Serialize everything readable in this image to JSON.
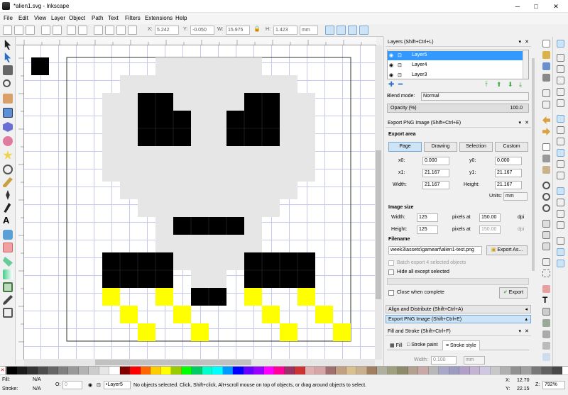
{
  "window": {
    "title": "*alien1.svg - Inkscape",
    "minimize": "─",
    "maximize": "□",
    "close": "✕"
  },
  "menu": [
    "File",
    "Edit",
    "View",
    "Layer",
    "Object",
    "Path",
    "Text",
    "Filters",
    "Extensions",
    "Help"
  ],
  "toolbar": {
    "x_label": "X:",
    "x_value": "5.242",
    "y_label": "Y:",
    "y_value": "-0.050",
    "w_label": "W:",
    "w_value": "15.975",
    "h_label": "H:",
    "h_value": "1.423",
    "units": "mm"
  },
  "layers": {
    "title": "Layers (Shift+Ctrl+L)",
    "items": [
      "Layer5",
      "Layer4",
      "Layer3"
    ],
    "blend_label": "Blend mode:",
    "blend_value": "Normal",
    "opacity_label": "Opacity (%)",
    "opacity_value": "100.0",
    "opacity": 1.0
  },
  "export": {
    "title": "Export PNG Image (Shift+Ctrl+E)",
    "area_heading": "Export area",
    "area_tabs": [
      "Page",
      "Drawing",
      "Selection",
      "Custom"
    ],
    "x0_label": "x0:",
    "x0": "0.000",
    "y0_label": "y0:",
    "y0": "0.000",
    "x1_label": "x1:",
    "x1": "21.167",
    "y1_label": "y1:",
    "y1": "21.167",
    "width_label": "Width:",
    "width": "21.167",
    "height_label": "Height:",
    "height": "21.167",
    "units_label": "Units:",
    "units": "mm",
    "size_heading": "Image size",
    "px_width_label": "Width:",
    "px_width": "125",
    "px_height_label": "Height:",
    "px_height": "125",
    "pixels_at": "pixels at",
    "dpi": "150.00",
    "dpi2": "150.00",
    "dpi_label": "dpi",
    "filename_heading": "Filename",
    "filename": "week3\\assets\\gameart\\alien1-test.png",
    "export_as": "Export As...",
    "batch": "Batch export 4 selected objects",
    "hide_all": "Hide all except selected",
    "close_when": "Close when complete",
    "export_btn": "Export"
  },
  "collapsed": {
    "align": "Align and Distribute (Shift+Ctrl+A)",
    "export": "Export PNG Image (Shift+Ctrl+E)"
  },
  "fill_stroke": {
    "title": "Fill and Stroke (Shift+Ctrl+F)",
    "tabs": [
      "Fill",
      "Stroke paint",
      "Stroke style"
    ],
    "width_label": "Width:",
    "width_value": "0.100",
    "width_units": "mm"
  },
  "status": {
    "fill_label": "Fill:",
    "fill_value": "N/A",
    "stroke_label": "Stroke:",
    "stroke_value": "N/A",
    "opacity_label": "O:",
    "opacity_value": "0",
    "layer": "•Layer5",
    "message": "No objects selected. Click, Shift+click, Alt+scroll mouse on top of objects, or drag around objects to select.",
    "x_label": "X:",
    "x_value": "12.70",
    "y_label": "Y:",
    "y_value": "22.15",
    "zoom_label": "Z:",
    "zoom_value": "792%"
  },
  "colors": {
    "light_gray": "#e6e6e6",
    "black": "#000000",
    "yellow": "#ffff00",
    "selection": "#3399ff",
    "accent": "#cde4f7"
  },
  "palette": [
    "#000000",
    "#1a1a1a",
    "#333333",
    "#4d4d4d",
    "#666666",
    "#808080",
    "#999999",
    "#b3b3b3",
    "#cccccc",
    "#e6e6e6",
    "#ffffff",
    "#800000",
    "#ff0000",
    "#ff6600",
    "#ffcc00",
    "#ffff00",
    "#99cc00",
    "#00ff00",
    "#00cc66",
    "#00ffcc",
    "#00ffff",
    "#0099ff",
    "#0000ff",
    "#6600ff",
    "#9900ff",
    "#ff00ff",
    "#ff0099",
    "#993366",
    "#cc3333",
    "#e0b0b0",
    "#d4a6a6",
    "#a07070",
    "#c0a080",
    "#d8c090",
    "#c8b090",
    "#a08060",
    "#b0b0a0",
    "#a0a080",
    "#8c8c6c",
    "#b4a090",
    "#c8a8a8",
    "#b8b8b8",
    "#a8a8c8",
    "#9c9cc0",
    "#b0a0c8",
    "#c4b4d4",
    "#d0c8e0",
    "#c8c8c8",
    "#b0b0b0",
    "#909090",
    "#a0a0a0",
    "#787878",
    "#606060",
    "#484848"
  ]
}
